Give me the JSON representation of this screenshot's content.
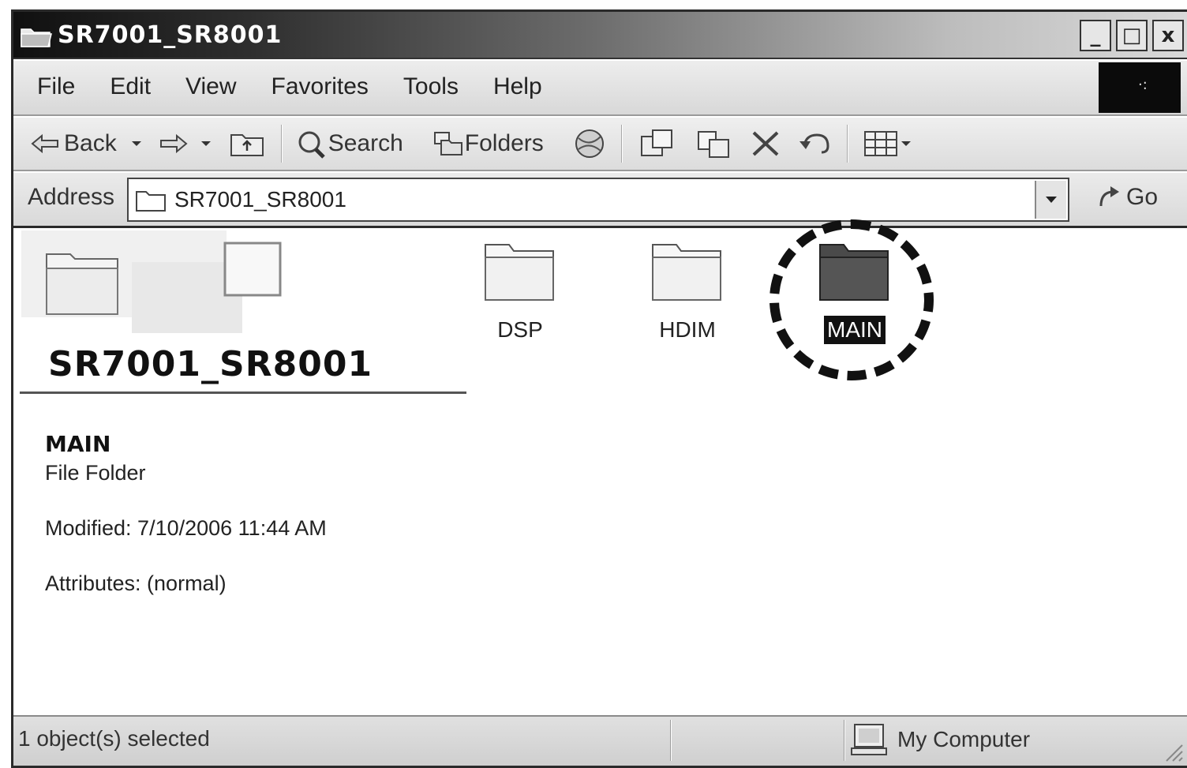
{
  "window": {
    "title": "SR7001_SR8001",
    "buttons": {
      "minimize": "_",
      "maximize": "□",
      "close": "x"
    }
  },
  "menu": [
    "File",
    "Edit",
    "View",
    "Favorites",
    "Tools",
    "Help"
  ],
  "toolbar": {
    "back_label": "Back",
    "search_label": "Search",
    "folders_label": "Folders"
  },
  "address": {
    "label": "Address",
    "value": "SR7001_SR8001",
    "go_label": "Go"
  },
  "left_pane": {
    "folder_title": "SR7001_SR8001",
    "selected_name": "MAIN",
    "selected_type": "File Folder",
    "modified": "Modified: 7/10/2006 11:44 AM",
    "attributes": "Attributes: (normal)"
  },
  "folders": [
    {
      "name": "DSP",
      "selected": false
    },
    {
      "name": "HDIM",
      "selected": false
    },
    {
      "name": "MAIN",
      "selected": true
    }
  ],
  "statusbar": {
    "selection": "1 object(s) selected",
    "zone": "My Computer"
  }
}
